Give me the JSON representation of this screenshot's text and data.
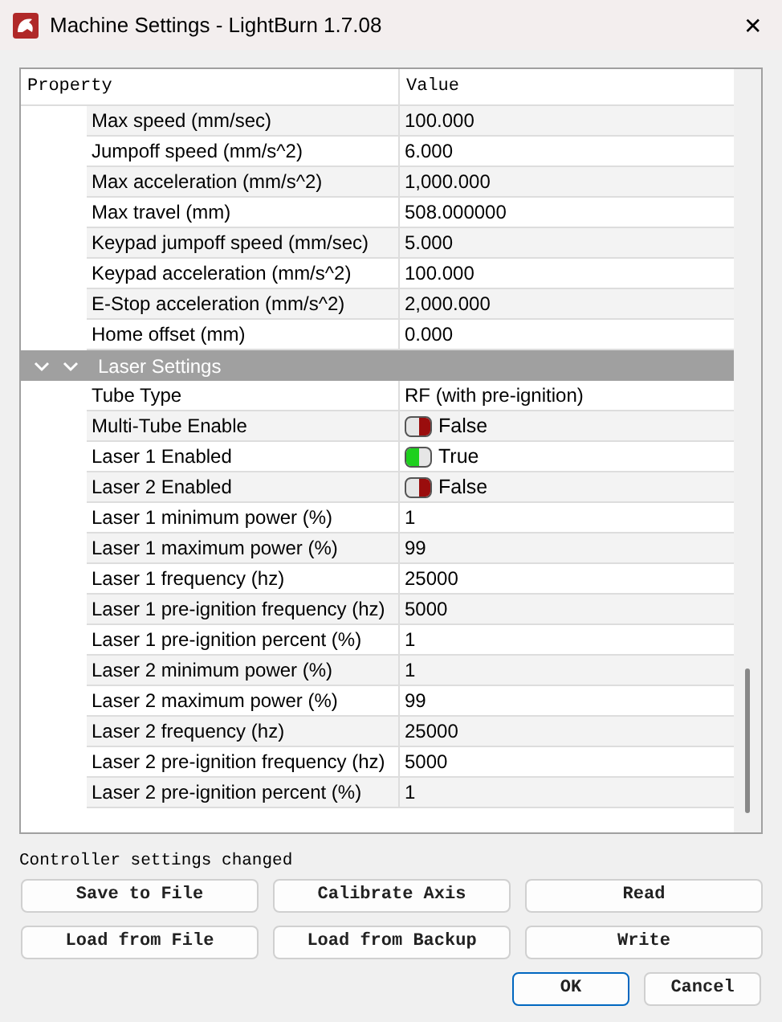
{
  "window": {
    "title": "Machine Settings - LightBurn 1.7.08",
    "close": "✕"
  },
  "table": {
    "columns": [
      "Property",
      "Value"
    ],
    "rows": [
      {
        "kind": "text",
        "property": "Max speed (mm/sec)",
        "value": "100.000"
      },
      {
        "kind": "text",
        "property": "Jumpoff speed (mm/s^2)",
        "value": "6.000"
      },
      {
        "kind": "text",
        "property": "Max acceleration (mm/s^2)",
        "value": "1,000.000"
      },
      {
        "kind": "text",
        "property": "Max travel (mm)",
        "value": "508.000000"
      },
      {
        "kind": "text",
        "property": "Keypad jumpoff speed (mm/sec)",
        "value": "5.000"
      },
      {
        "kind": "text",
        "property": "Keypad acceleration (mm/s^2)",
        "value": "100.000"
      },
      {
        "kind": "text",
        "property": "E-Stop acceleration (mm/s^2)",
        "value": "2,000.000"
      },
      {
        "kind": "text",
        "property": "Home offset (mm)",
        "value": "0.000"
      },
      {
        "kind": "group",
        "property": "Laser Settings",
        "expanded": true
      },
      {
        "kind": "text",
        "property": "Tube Type",
        "value": "RF (with pre-ignition)"
      },
      {
        "kind": "toggle",
        "property": "Multi-Tube Enable",
        "value": "False",
        "on": false
      },
      {
        "kind": "toggle",
        "property": "Laser 1 Enabled",
        "value": "True",
        "on": true
      },
      {
        "kind": "toggle",
        "property": "Laser 2 Enabled",
        "value": "False",
        "on": false
      },
      {
        "kind": "text",
        "property": "Laser 1 minimum power (%)",
        "value": "1"
      },
      {
        "kind": "text",
        "property": "Laser 1 maximum power (%)",
        "value": "99"
      },
      {
        "kind": "text",
        "property": "Laser 1 frequency (hz)",
        "value": "25000"
      },
      {
        "kind": "text",
        "property": "Laser 1 pre-ignition frequency (hz)",
        "value": "5000"
      },
      {
        "kind": "text",
        "property": "Laser 1 pre-ignition percent (%)",
        "value": "1"
      },
      {
        "kind": "text",
        "property": "Laser 2 minimum power (%)",
        "value": "1"
      },
      {
        "kind": "text",
        "property": "Laser 2 maximum power (%)",
        "value": "99"
      },
      {
        "kind": "text",
        "property": "Laser 2 frequency (hz)",
        "value": "25000"
      },
      {
        "kind": "text",
        "property": "Laser 2 pre-ignition frequency (hz)",
        "value": "5000"
      },
      {
        "kind": "text",
        "property": "Laser 2 pre-ignition percent (%)",
        "value": "1"
      }
    ]
  },
  "status": "Controller settings changed",
  "buttons": [
    [
      "Save to File",
      "Calibrate Axis",
      "Read"
    ],
    [
      "Load from File",
      "Load from Backup",
      "Write"
    ]
  ],
  "dialog_buttons": [
    {
      "label": "OK",
      "default": true
    },
    {
      "label": "Cancel",
      "default": false
    }
  ]
}
